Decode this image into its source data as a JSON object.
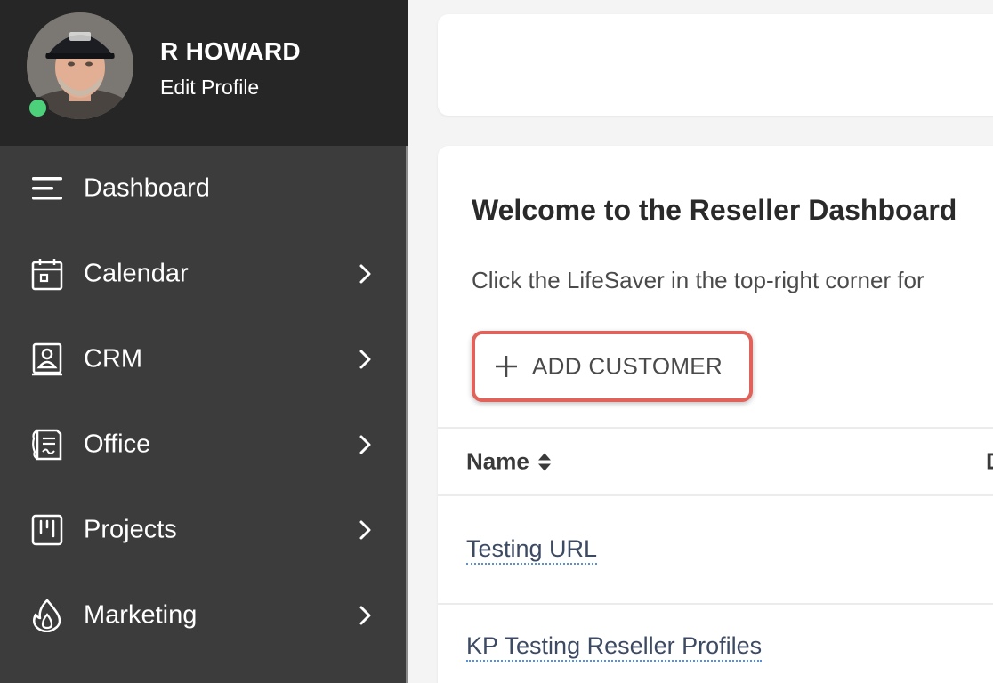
{
  "profile": {
    "name": "R HOWARD",
    "edit_label": "Edit Profile",
    "status_color": "#4cd17a"
  },
  "nav": {
    "items": [
      {
        "label": "Dashboard",
        "icon": "menu-icon",
        "has_submenu": false
      },
      {
        "label": "Calendar",
        "icon": "calendar-icon",
        "has_submenu": true
      },
      {
        "label": "CRM",
        "icon": "contact-book-icon",
        "has_submenu": true
      },
      {
        "label": "Office",
        "icon": "document-icon",
        "has_submenu": true
      },
      {
        "label": "Projects",
        "icon": "kanban-icon",
        "has_submenu": true
      },
      {
        "label": "Marketing",
        "icon": "flame-icon",
        "has_submenu": true
      }
    ]
  },
  "main": {
    "title": "Welcome to the Reseller Dashboard",
    "description": "Click the LifeSaver in the top-right corner for",
    "add_button_label": "ADD CUSTOMER",
    "highlight_color": "#e0625a",
    "table": {
      "columns": [
        "Name",
        "D"
      ],
      "rows": [
        {
          "name": "Testing URL"
        },
        {
          "name": "KP Testing Reseller Profiles"
        }
      ]
    }
  },
  "colors": {
    "sidebar_bg": "#3c3c3c",
    "profile_bg": "#262626",
    "page_bg": "#f4f4f4",
    "link_underline": "#5b8fd6"
  }
}
